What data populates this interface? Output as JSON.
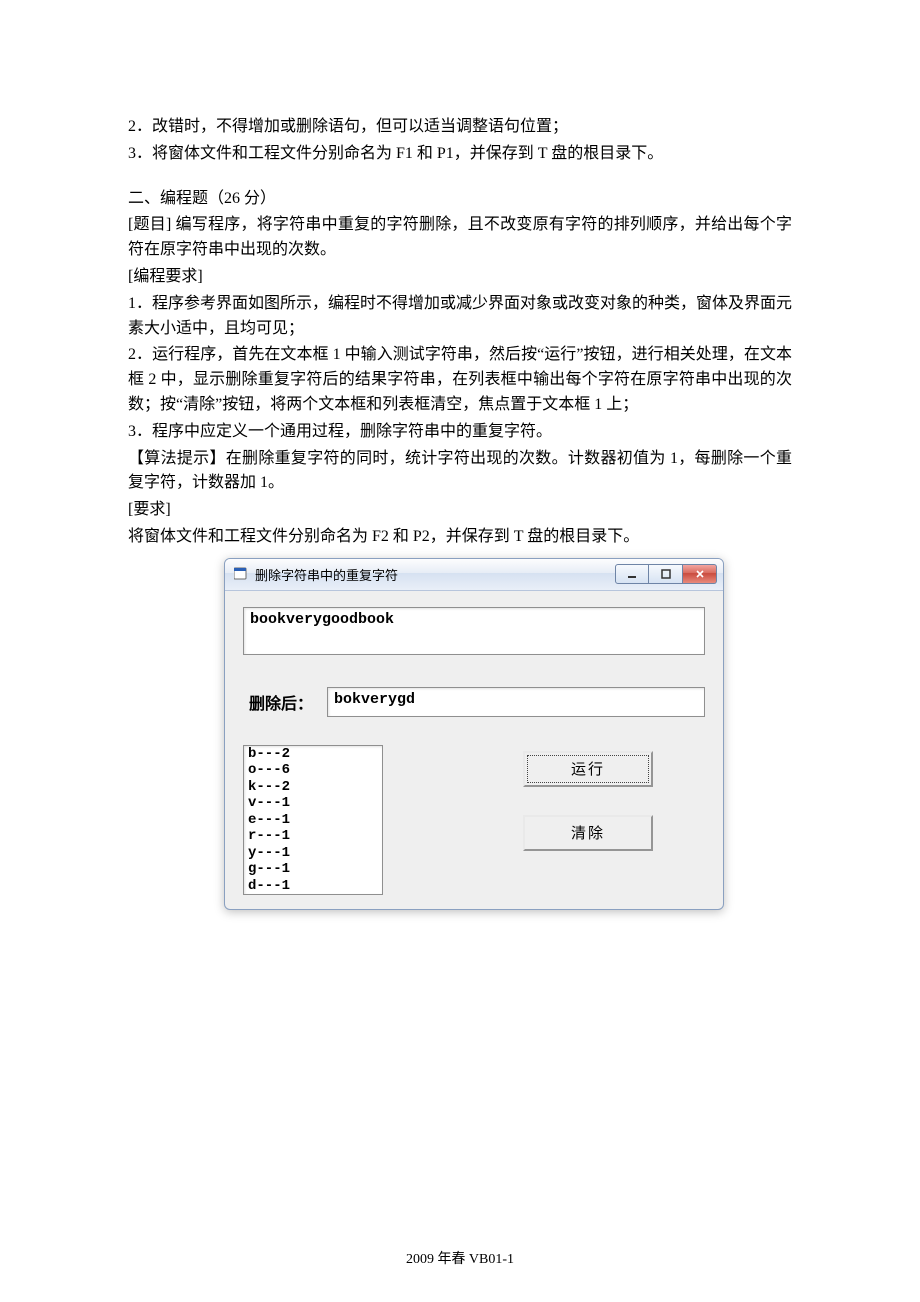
{
  "text": {
    "p1": "2．改错时，不得增加或删除语句，但可以适当调整语句位置；",
    "p2": "3．将窗体文件和工程文件分别命名为 F1 和 P1，并保存到 T 盘的根目录下。",
    "section2_title": "二、编程题（26 分）",
    "p3": "[题目]  编写程序，将字符串中重复的字符删除，且不改变原有字符的排列顺序，并给出每个字符在原字符串中出现的次数。",
    "p4": "[编程要求]",
    "p5": "1．程序参考界面如图所示，编程时不得增加或减少界面对象或改变对象的种类，窗体及界面元素大小适中，且均可见；",
    "p6": "2．运行程序，首先在文本框 1 中输入测试字符串，然后按“运行”按钮，进行相关处理，在文本框 2 中，显示删除重复字符后的结果字符串，在列表框中输出每个字符在原字符串中出现的次数；按“清除”按钮，将两个文本框和列表框清空，焦点置于文本框 1 上；",
    "p7": "3．程序中应定义一个通用过程，删除字符串中的重复字符。",
    "p8": "【算法提示】在删除重复字符的同时，统计字符出现的次数。计数器初值为 1，每删除一个重复字符，计数器加 1。",
    "p9": "[要求]",
    "p10": "将窗体文件和工程文件分别命名为 F2 和 P2，并保存到 T 盘的根目录下。",
    "footer": "2009 年春 VB01-1"
  },
  "window": {
    "title": "删除字符串中的重复字符",
    "text1_value": "bookverygoodbook",
    "label_after": "删除后：",
    "text2_value": "bokverygd",
    "list_items": [
      "b---2",
      "o---6",
      "k---2",
      "v---1",
      "e---1",
      "r---1",
      "y---1",
      "g---1",
      "d---1"
    ],
    "btn_run": "运行",
    "btn_clear": "清除"
  }
}
